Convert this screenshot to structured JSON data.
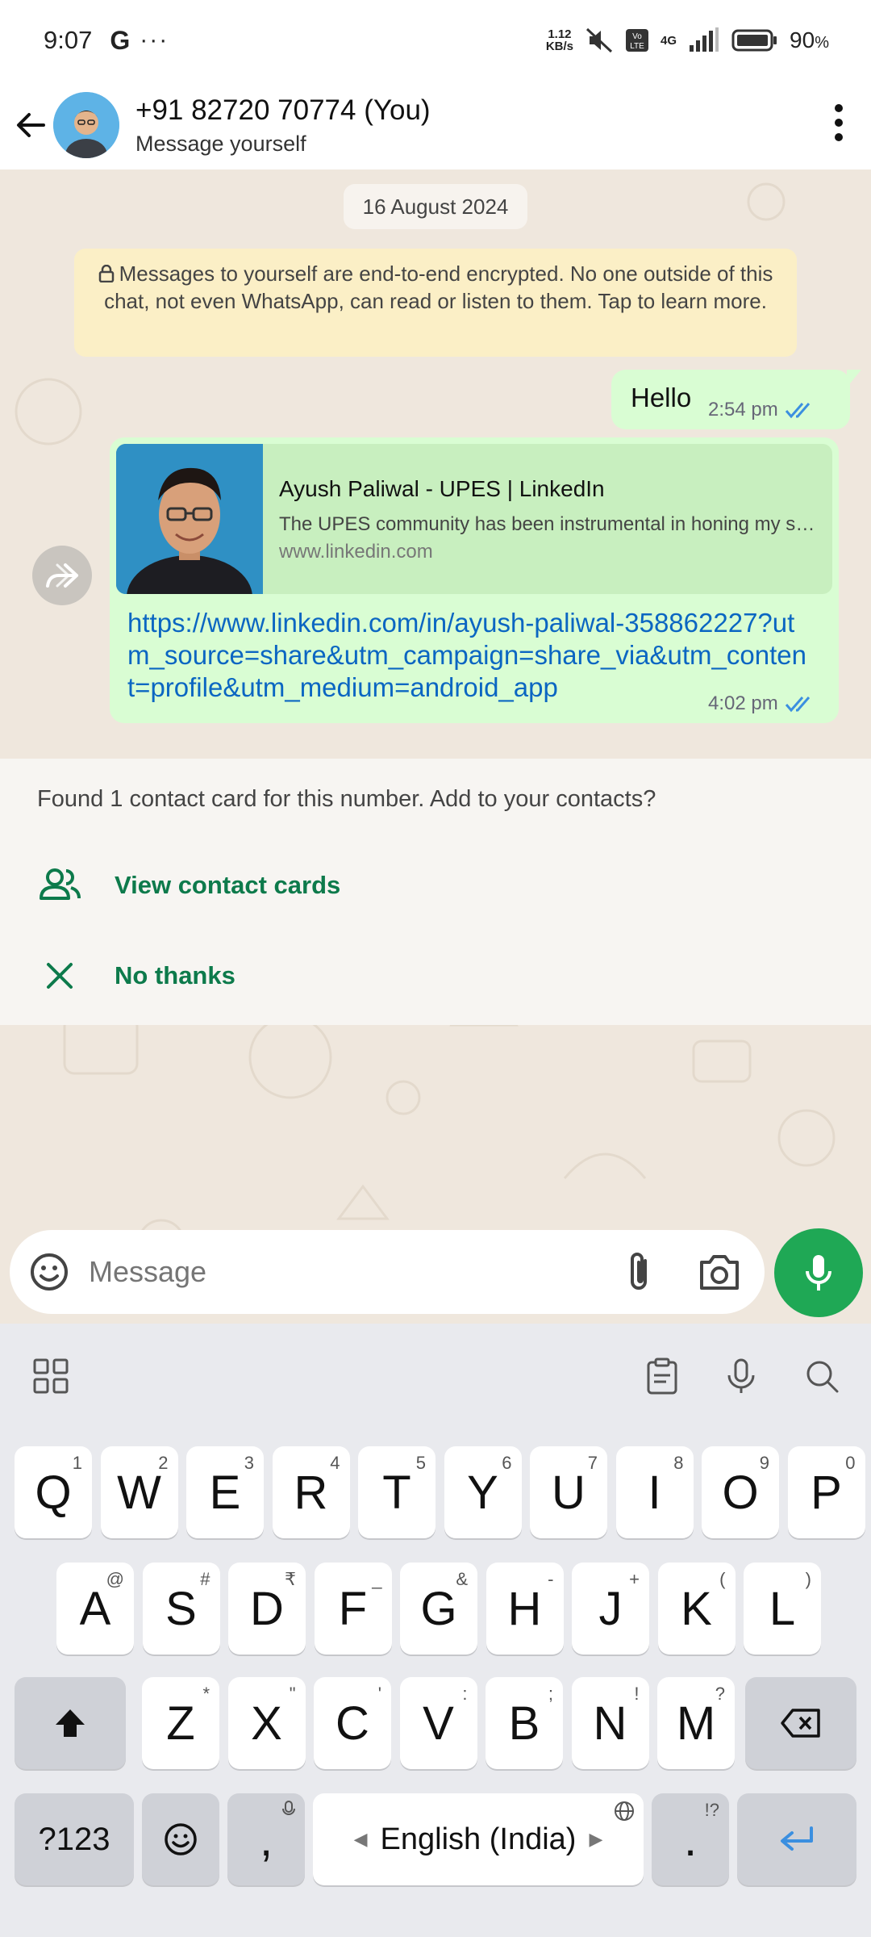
{
  "status": {
    "time": "9:07",
    "carrier_icon": "G",
    "more": "···",
    "net_speed_top": "1.12",
    "net_speed_bottom": "KB/s",
    "network": "4G",
    "battery_pct": "90",
    "battery_unit": "%"
  },
  "header": {
    "title": "+91 82720 70774 (You)",
    "subtitle": "Message yourself"
  },
  "chat": {
    "date_chip": "16 August 2024",
    "encryption_note": "Messages to yourself are end-to-end encrypted. No one outside of this chat, not even WhatsApp, can read or listen to them. Tap to learn more.",
    "messages": [
      {
        "text": "Hello",
        "time": "2:54 pm"
      },
      {
        "preview_title": "Ayush Paliwal - UPES | LinkedIn",
        "preview_desc": "The UPES community has been instrumental in honing my skills and knowledge",
        "preview_domain": "www.linkedin.com",
        "link": "https://www.linkedin.com/in/ayush-paliwal-358862227?utm_source=share&utm_campaign=share_via&utm_content=profile&utm_medium=android_app",
        "time": "4:02 pm"
      }
    ]
  },
  "contact_panel": {
    "prompt": "Found 1 contact card for this number. Add to your contacts?",
    "view_label": "View contact cards",
    "dismiss_label": "No thanks"
  },
  "composer": {
    "placeholder": "Message"
  },
  "keyboard": {
    "row1": [
      {
        "k": "Q",
        "s": "1"
      },
      {
        "k": "W",
        "s": "2"
      },
      {
        "k": "E",
        "s": "3"
      },
      {
        "k": "R",
        "s": "4"
      },
      {
        "k": "T",
        "s": "5"
      },
      {
        "k": "Y",
        "s": "6"
      },
      {
        "k": "U",
        "s": "7"
      },
      {
        "k": "I",
        "s": "8"
      },
      {
        "k": "O",
        "s": "9"
      },
      {
        "k": "P",
        "s": "0"
      }
    ],
    "row2": [
      {
        "k": "A",
        "s": "@"
      },
      {
        "k": "S",
        "s": "#"
      },
      {
        "k": "D",
        "s": "₹"
      },
      {
        "k": "F",
        "s": "_"
      },
      {
        "k": "G",
        "s": "&"
      },
      {
        "k": "H",
        "s": "-"
      },
      {
        "k": "J",
        "s": "+"
      },
      {
        "k": "K",
        "s": "("
      },
      {
        "k": "L",
        "s": ")"
      }
    ],
    "row3": [
      {
        "k": "Z",
        "s": "*"
      },
      {
        "k": "X",
        "s": "\""
      },
      {
        "k": "C",
        "s": "'"
      },
      {
        "k": "V",
        "s": ":"
      },
      {
        "k": "B",
        "s": ";"
      },
      {
        "k": "N",
        "s": "!"
      },
      {
        "k": "M",
        "s": "?"
      }
    ],
    "symbols_label": "?123",
    "comma": ",",
    "space_label": "English (India)",
    "period": ".",
    "period_sub": "!?"
  },
  "colors": {
    "accent_green": "#1fa855",
    "outgoing_bubble": "#d9fdd3",
    "link_blue": "#0b66c2",
    "tick_blue": "#3b8fe0"
  }
}
